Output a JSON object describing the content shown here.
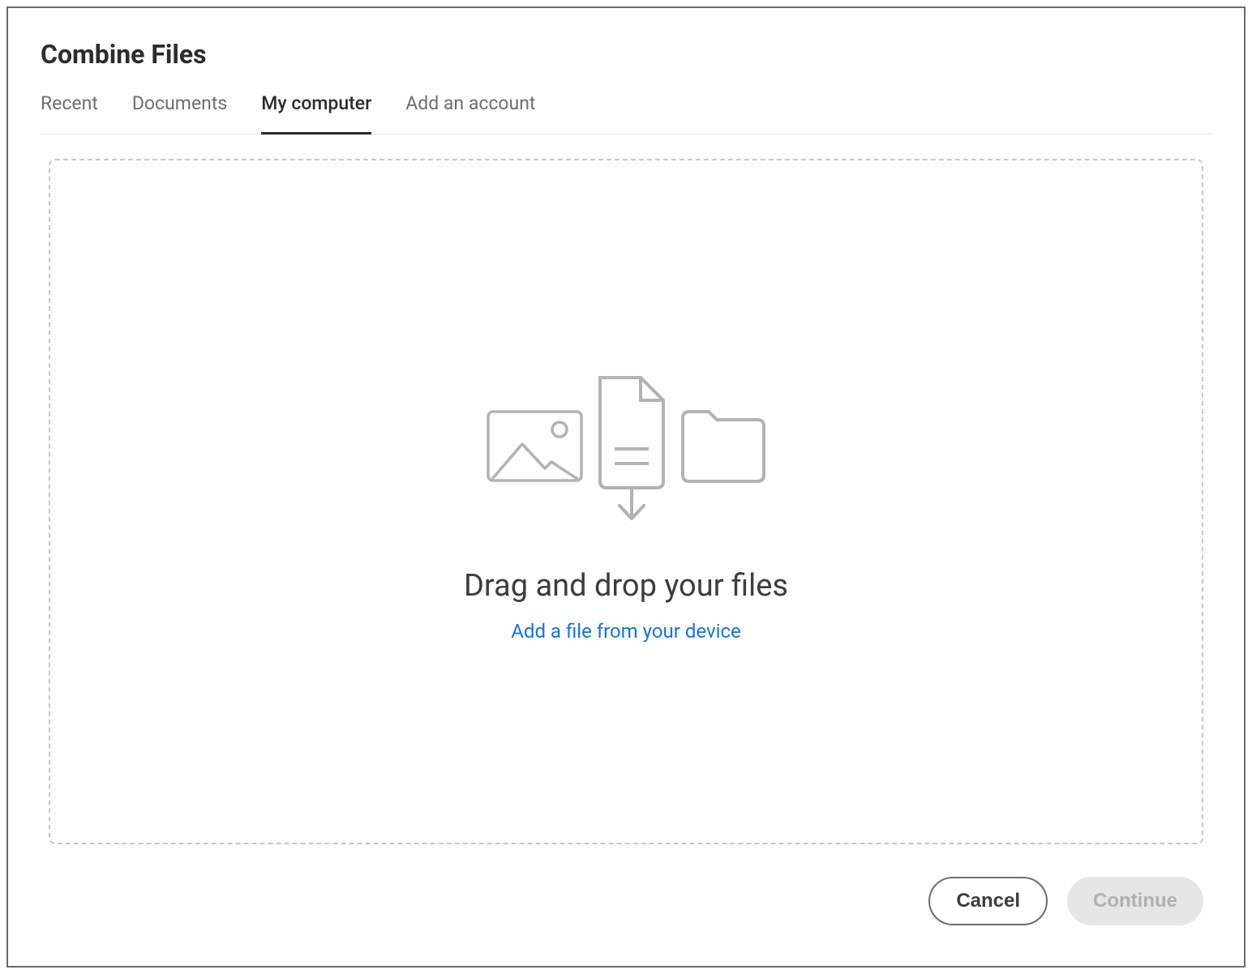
{
  "header": {
    "title": "Combine Files"
  },
  "tabs": [
    {
      "label": "Recent",
      "active": false
    },
    {
      "label": "Documents",
      "active": false
    },
    {
      "label": "My computer",
      "active": true
    },
    {
      "label": "Add an account",
      "active": false
    }
  ],
  "dropArea": {
    "title": "Drag and drop your files",
    "linkText": "Add a file from your device"
  },
  "footer": {
    "cancelLabel": "Cancel",
    "continueLabel": "Continue"
  }
}
